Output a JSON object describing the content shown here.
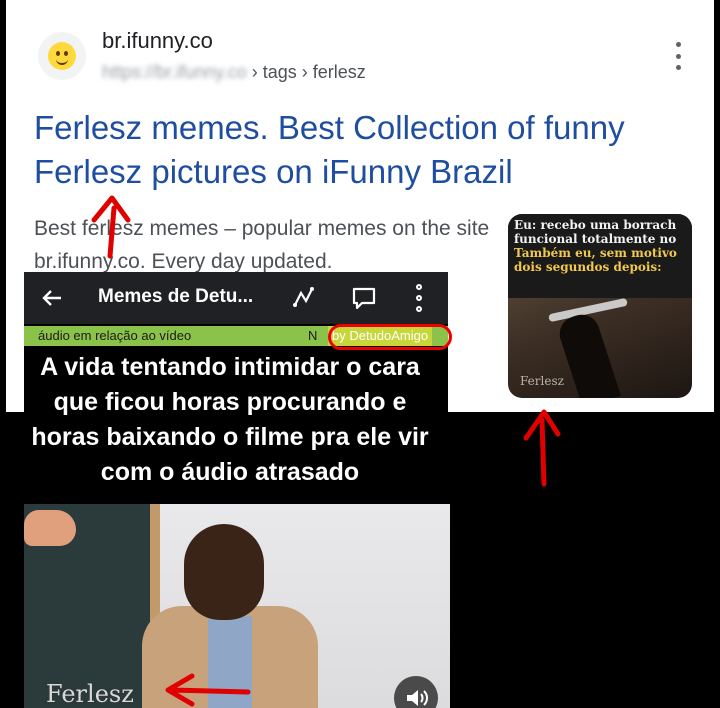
{
  "result": {
    "site_name": "br.ifunny.co",
    "breadcrumb_url": "https://br.ifunny.co",
    "breadcrumb_path": " › tags › ferlesz",
    "title": "Ferlesz memes. Best Collection of funny Ferlesz pictures on iFunny Brazil",
    "snippet": "Best ferlesz memes – popular memes on the site br.ifunny.co. Every day updated."
  },
  "thumbnail": {
    "line1": "Eu: recebo uma borrach",
    "line2": "funcional totalmente no",
    "line3": "Também eu, sem motivo",
    "line4": "dois segundos depois:",
    "watermark": "Ferlesz"
  },
  "video_app": {
    "title": "Memes de Detu...",
    "ticker_text": "áudio em relação ao vídeo",
    "ticker_fragment": "N",
    "author": "by DetudoAmigo"
  },
  "meme": {
    "caption": "A vida tentando intimidar o cara que ficou horas procurando e horas baixando o filme pra ele vir com o áudio atrasado",
    "watermark": "Ferlesz"
  },
  "colors": {
    "link_blue": "#1f4ea0",
    "annotation_red": "#e00000",
    "ticker_green": "#8bc34a"
  },
  "icons": [
    "smiley-favicon-icon",
    "more-vert-icon",
    "back-arrow-icon",
    "trend-icon",
    "comment-icon",
    "volume-icon"
  ]
}
